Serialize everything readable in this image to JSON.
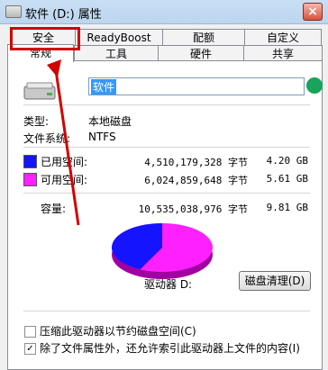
{
  "window": {
    "title": "软件 (D:) 属性",
    "close_glyph": "×"
  },
  "tabs_row1": [
    "安全",
    "ReadyBoost",
    "配额",
    "自定义"
  ],
  "tabs_row2": [
    "常规",
    "工具",
    "硬件",
    "共享"
  ],
  "general": {
    "drive_name": "软件",
    "type_label": "类型:",
    "type_value": "本地磁盘",
    "fs_label": "文件系统:",
    "fs_value": "NTFS",
    "used_label": "已用空间:",
    "used_bytes": "4,510,179,328 字节",
    "used_gb": "4.20 GB",
    "free_label": "可用空间:",
    "free_bytes": "6,024,859,648 字节",
    "free_gb": "5.61 GB",
    "capacity_label": "容量:",
    "capacity_bytes": "10,535,038,976 字节",
    "capacity_gb": "9.81 GB",
    "drive_label": "驱动器 D:",
    "cleanup_button": "磁盘清理(D)",
    "compress_option": "压缩此驱动器以节约磁盘空间(C)",
    "index_option": "除了文件属性外，还允许索引此驱动器上文件的内容(I)",
    "compress_checked": false,
    "index_checked": true,
    "index_check_glyph": "✓"
  },
  "colors": {
    "used": "#1414ff",
    "free": "#ff20ff",
    "highlight": "#d20000"
  },
  "pie": {
    "used_fraction": 0.428,
    "free_fraction": 0.572
  }
}
